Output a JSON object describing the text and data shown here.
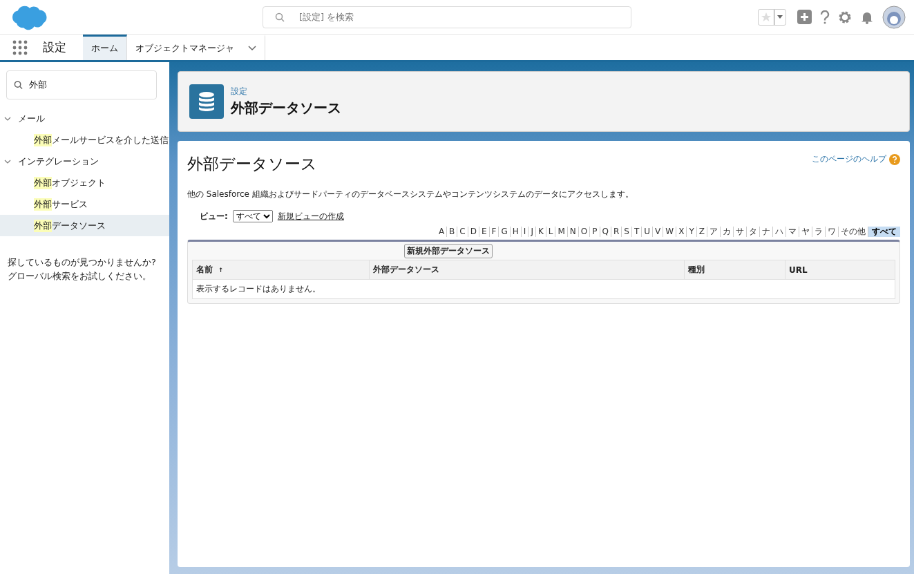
{
  "header": {
    "search_placeholder": "[設定] を検索"
  },
  "nav": {
    "app_name": "設定",
    "tabs": [
      {
        "label": "ホーム",
        "selected": true,
        "dropdown": false
      },
      {
        "label": "オブジェクトマネージャ",
        "selected": false,
        "dropdown": true
      }
    ]
  },
  "sidebar": {
    "search_value": "外部",
    "tree": [
      {
        "label": "メール",
        "expanded": true,
        "children": [
          {
            "match": "外部",
            "rest": "メールサービスを介した送信",
            "selected": false
          }
        ]
      },
      {
        "label": "インテグレーション",
        "expanded": true,
        "children": [
          {
            "match": "外部",
            "rest": "オブジェクト",
            "selected": false
          },
          {
            "match": "外部",
            "rest": "サービス",
            "selected": false
          },
          {
            "match": "外部",
            "rest": "データソース",
            "selected": true
          }
        ]
      }
    ],
    "not_found": [
      "探しているものが見つかりませんか?",
      "グローバル検索をお試しください。"
    ]
  },
  "page_header": {
    "breadcrumb": "設定",
    "title": "外部データソース"
  },
  "content": {
    "title": "外部データソース",
    "help_link": "このページのヘルプ",
    "description": "他の Salesforce 組織およびサードパーティのデータベースシステムやコンテンツシステムのデータにアクセスします。",
    "view_label": "ビュー:",
    "view_value": "すべて",
    "new_view_link": "新規ビューの作成",
    "letters": [
      {
        "label": "A",
        "selected": false
      },
      {
        "label": "B",
        "selected": false
      },
      {
        "label": "C",
        "selected": false
      },
      {
        "label": "D",
        "selected": false
      },
      {
        "label": "E",
        "selected": false
      },
      {
        "label": "F",
        "selected": false
      },
      {
        "label": "G",
        "selected": false
      },
      {
        "label": "H",
        "selected": false
      },
      {
        "label": "I",
        "selected": false
      },
      {
        "label": "J",
        "selected": false
      },
      {
        "label": "K",
        "selected": false
      },
      {
        "label": "L",
        "selected": false
      },
      {
        "label": "M",
        "selected": false
      },
      {
        "label": "N",
        "selected": false
      },
      {
        "label": "O",
        "selected": false
      },
      {
        "label": "P",
        "selected": false
      },
      {
        "label": "Q",
        "selected": false
      },
      {
        "label": "R",
        "selected": false
      },
      {
        "label": "S",
        "selected": false
      },
      {
        "label": "T",
        "selected": false
      },
      {
        "label": "U",
        "selected": false
      },
      {
        "label": "V",
        "selected": false
      },
      {
        "label": "W",
        "selected": false
      },
      {
        "label": "X",
        "selected": false
      },
      {
        "label": "Y",
        "selected": false
      },
      {
        "label": "Z",
        "selected": false
      },
      {
        "label": "ア",
        "selected": false
      },
      {
        "label": "カ",
        "selected": false
      },
      {
        "label": "サ",
        "selected": false
      },
      {
        "label": "タ",
        "selected": false
      },
      {
        "label": "ナ",
        "selected": false
      },
      {
        "label": "ハ",
        "selected": false
      },
      {
        "label": "マ",
        "selected": false
      },
      {
        "label": "ヤ",
        "selected": false
      },
      {
        "label": "ラ",
        "selected": false
      },
      {
        "label": "ワ",
        "selected": false
      },
      {
        "label": "その他",
        "selected": false
      },
      {
        "label": "すべて",
        "selected": true
      }
    ],
    "new_button": "新規外部データソース",
    "table": {
      "columns": [
        {
          "label": "名前",
          "sort": "↑"
        },
        {
          "label": "外部データソース"
        },
        {
          "label": "種別"
        },
        {
          "label": "URL"
        }
      ],
      "empty_message": "表示するレコードはありません。"
    }
  }
}
